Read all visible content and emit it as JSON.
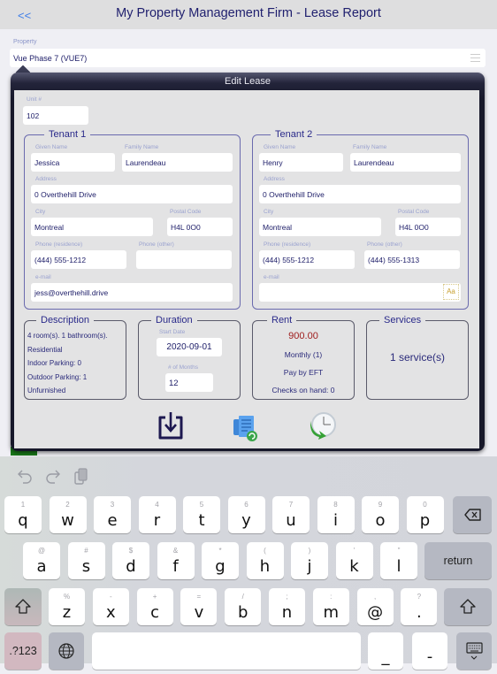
{
  "header": {
    "back_label": "<<",
    "title": "My Property Management Firm - Lease Report"
  },
  "property": {
    "label": "Property",
    "value": "Vue Phase 7 (VUE7)"
  },
  "popover": {
    "title": "Edit Lease",
    "unit": {
      "label": "Unit #",
      "value": "102"
    },
    "tenants": [
      {
        "legend": "Tenant 1",
        "given_name_label": "Given Name",
        "given_name": "Jessica",
        "family_name_label": "Family Name",
        "family_name": "Laurendeau",
        "address_label": "Address",
        "address": "0 Overthehill Drive",
        "city_label": "City",
        "city": "Montreal",
        "postal_label": "Postal Code",
        "postal": "H4L 0O0",
        "phone_res_label": "Phone (residence)",
        "phone_res": "(444) 555-1212",
        "phone_other_label": "Phone (other)",
        "phone_other": "",
        "email_label": "e-mail",
        "email": "jess@overthehill.drive"
      },
      {
        "legend": "Tenant 2",
        "given_name_label": "Given Name",
        "given_name": "Henry",
        "family_name_label": "Family Name",
        "family_name": "Laurendeau",
        "address_label": "Address",
        "address": "0 Overthehill Drive",
        "city_label": "City",
        "city": "Montreal",
        "postal_label": "Postal Code",
        "postal": "H4L 0O0",
        "phone_res_label": "Phone (residence)",
        "phone_res": "(444) 555-1212",
        "phone_other_label": "Phone (other)",
        "phone_other": "(444) 555-1313",
        "email_label": "e-mail",
        "email": "",
        "email_accessory": "Aa"
      }
    ],
    "description": {
      "legend": "Description",
      "lines": [
        "4 room(s). 1 bathroom(s).",
        "Residential",
        "Indoor Parking: 0",
        "Outdoor Parking: 1",
        "Unfurnished"
      ]
    },
    "duration": {
      "legend": "Duration",
      "start_label": "Start Date",
      "start": "2020-09-01",
      "months_label": "# of Months",
      "months": "12"
    },
    "rent": {
      "legend": "Rent",
      "amount": "900.00",
      "amount_color": "#a02020",
      "frequency": "Monthly (1)",
      "payment": "Pay by EFT",
      "checks": "Checks on hand: 0"
    },
    "services": {
      "legend": "Services",
      "summary": "1 service(s)"
    },
    "actions": [
      {
        "icon": "save-download-icon"
      },
      {
        "icon": "document-refresh-icon"
      },
      {
        "icon": "clock-history-icon"
      }
    ]
  },
  "keyboard": {
    "toolbar": [
      "undo-icon",
      "redo-icon",
      "paste-icon"
    ],
    "row1": [
      {
        "k": "q",
        "s": "1"
      },
      {
        "k": "w",
        "s": "2"
      },
      {
        "k": "e",
        "s": "3"
      },
      {
        "k": "r",
        "s": "4"
      },
      {
        "k": "t",
        "s": "5"
      },
      {
        "k": "y",
        "s": "6"
      },
      {
        "k": "u",
        "s": "7"
      },
      {
        "k": "i",
        "s": "8"
      },
      {
        "k": "o",
        "s": "9"
      },
      {
        "k": "p",
        "s": "0"
      }
    ],
    "row2": [
      {
        "k": "a",
        "s": "@"
      },
      {
        "k": "s",
        "s": "#"
      },
      {
        "k": "d",
        "s": "$"
      },
      {
        "k": "f",
        "s": "&"
      },
      {
        "k": "g",
        "s": "*"
      },
      {
        "k": "h",
        "s": "("
      },
      {
        "k": "j",
        "s": ")"
      },
      {
        "k": "k",
        "s": "'"
      },
      {
        "k": "l",
        "s": "\""
      }
    ],
    "row3": [
      {
        "k": "z",
        "s": "%"
      },
      {
        "k": "x",
        "s": "-"
      },
      {
        "k": "c",
        "s": "+"
      },
      {
        "k": "v",
        "s": "="
      },
      {
        "k": "b",
        "s": "/"
      },
      {
        "k": "n",
        "s": ";"
      },
      {
        "k": "m",
        "s": ":"
      },
      {
        "k": "@",
        "s": ","
      },
      {
        "k": ".",
        "s": "?"
      }
    ],
    "return_label": "return",
    "numbers_label": ".?123",
    "underscore": "_",
    "hyphen": "-"
  }
}
